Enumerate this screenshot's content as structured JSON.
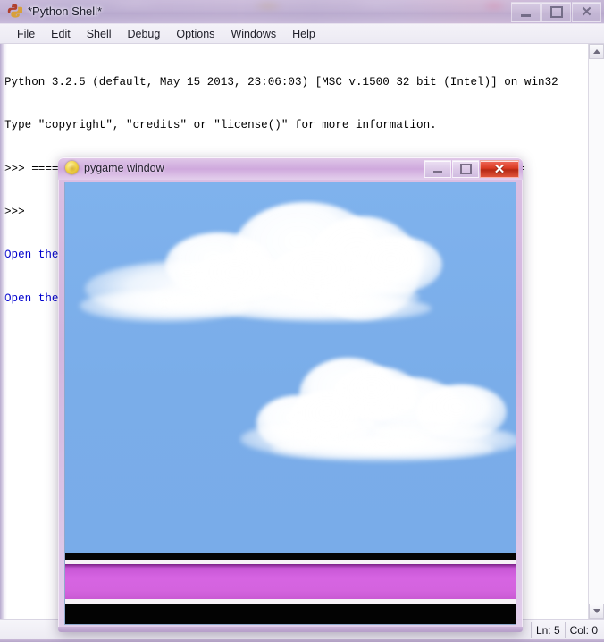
{
  "desktop": {
    "description": "blurred lavender desktop background behind window"
  },
  "idle_window": {
    "title": "*Python Shell*",
    "icon": "python-logo-icon",
    "window_controls": {
      "minimize_label": "",
      "maximize_label": "",
      "close_label": "✕"
    },
    "menu": [
      {
        "label": "File"
      },
      {
        "label": "Edit"
      },
      {
        "label": "Shell"
      },
      {
        "label": "Debug"
      },
      {
        "label": "Options"
      },
      {
        "label": "Windows"
      },
      {
        "label": "Help"
      }
    ],
    "shell_lines": [
      {
        "text": "Python 3.2.5 (default, May 15 2013, 23:06:03) [MSC v.1500 32 bit (Intel)] on win32",
        "color": "#000000"
      },
      {
        "text": "Type \"copyright\", \"credits\" or \"license()\" for more information.",
        "color": "#000000"
      },
      {
        "text": ">>> ================================ RESTART ================================",
        "color": "#000000"
      },
      {
        "text": ">>> ",
        "color": "#000000"
      },
      {
        "text": "Open the Fullscreen model!",
        "color": "#0000cd"
      },
      {
        "text": "Open the Default model!",
        "color": "#0000cd"
      }
    ],
    "status_bar": {
      "line_label": "Ln: 5",
      "col_label": "Col: 0"
    },
    "scrollbar": {
      "up_icon": "triangle-up-icon",
      "down_icon": "triangle-down-icon"
    }
  },
  "pygame_window": {
    "title": "pygame window",
    "icon": "pygame-yellow-icon",
    "window_controls": {
      "minimize_label": "",
      "maximize_label": "",
      "close_label": "✕"
    },
    "canvas": {
      "sky_color": "#7bade9",
      "cloud_color": "#ffffff",
      "band_black_color": "#050505",
      "band_white_color": "#f7f2f7",
      "band_magenta_color": "#d664e2",
      "clouds": [
        {
          "name": "upper-left-cloud"
        },
        {
          "name": "lower-right-cloud"
        }
      ]
    }
  },
  "colors": {
    "sky": "#7bade9",
    "magenta": "#d664e2",
    "shell_blue_text": "#0000cd",
    "close_button_red": "#d93a22",
    "titlebar_lavender": "#cfa9dd"
  }
}
